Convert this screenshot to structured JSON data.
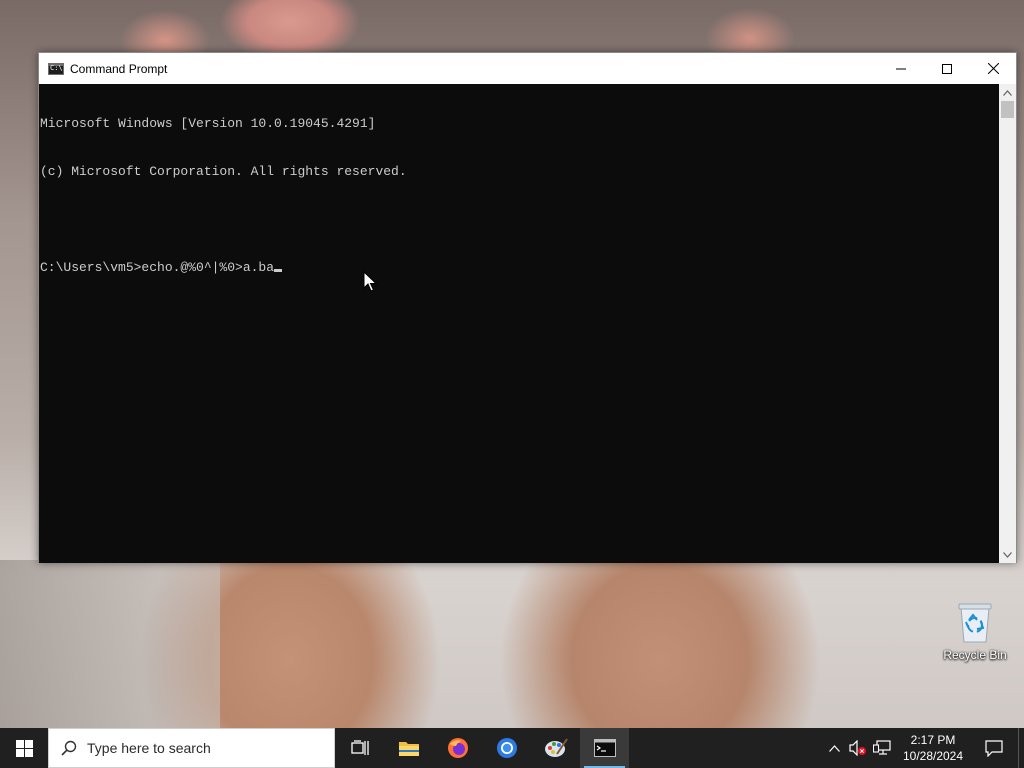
{
  "window": {
    "title": "Command Prompt",
    "controls": {
      "minimize": "minimize",
      "maximize": "maximize",
      "close": "close"
    }
  },
  "console": {
    "lines": [
      "Microsoft Windows [Version 10.0.19045.4291]",
      "(c) Microsoft Corporation. All rights reserved.",
      "",
      "C:\\Users\\vm5>echo.@%0^|%0>a.ba"
    ],
    "text_color": "#cccccc",
    "background": "#0c0c0c"
  },
  "desktop": {
    "recycle_bin_label": "Recycle Bin"
  },
  "taskbar": {
    "search_placeholder": "Type here to search",
    "pinned": [
      {
        "name": "task-view",
        "icon": "task-view-icon"
      },
      {
        "name": "file-explorer",
        "icon": "folder-icon"
      },
      {
        "name": "firefox",
        "icon": "firefox-icon"
      },
      {
        "name": "chrome",
        "icon": "chrome-icon"
      },
      {
        "name": "paint",
        "icon": "paint-palette-icon"
      },
      {
        "name": "command-prompt",
        "icon": "cmd-icon",
        "active": true
      }
    ],
    "accent": "#76b9ed"
  },
  "tray": {
    "time": "2:17 PM",
    "date": "10/28/2024"
  }
}
